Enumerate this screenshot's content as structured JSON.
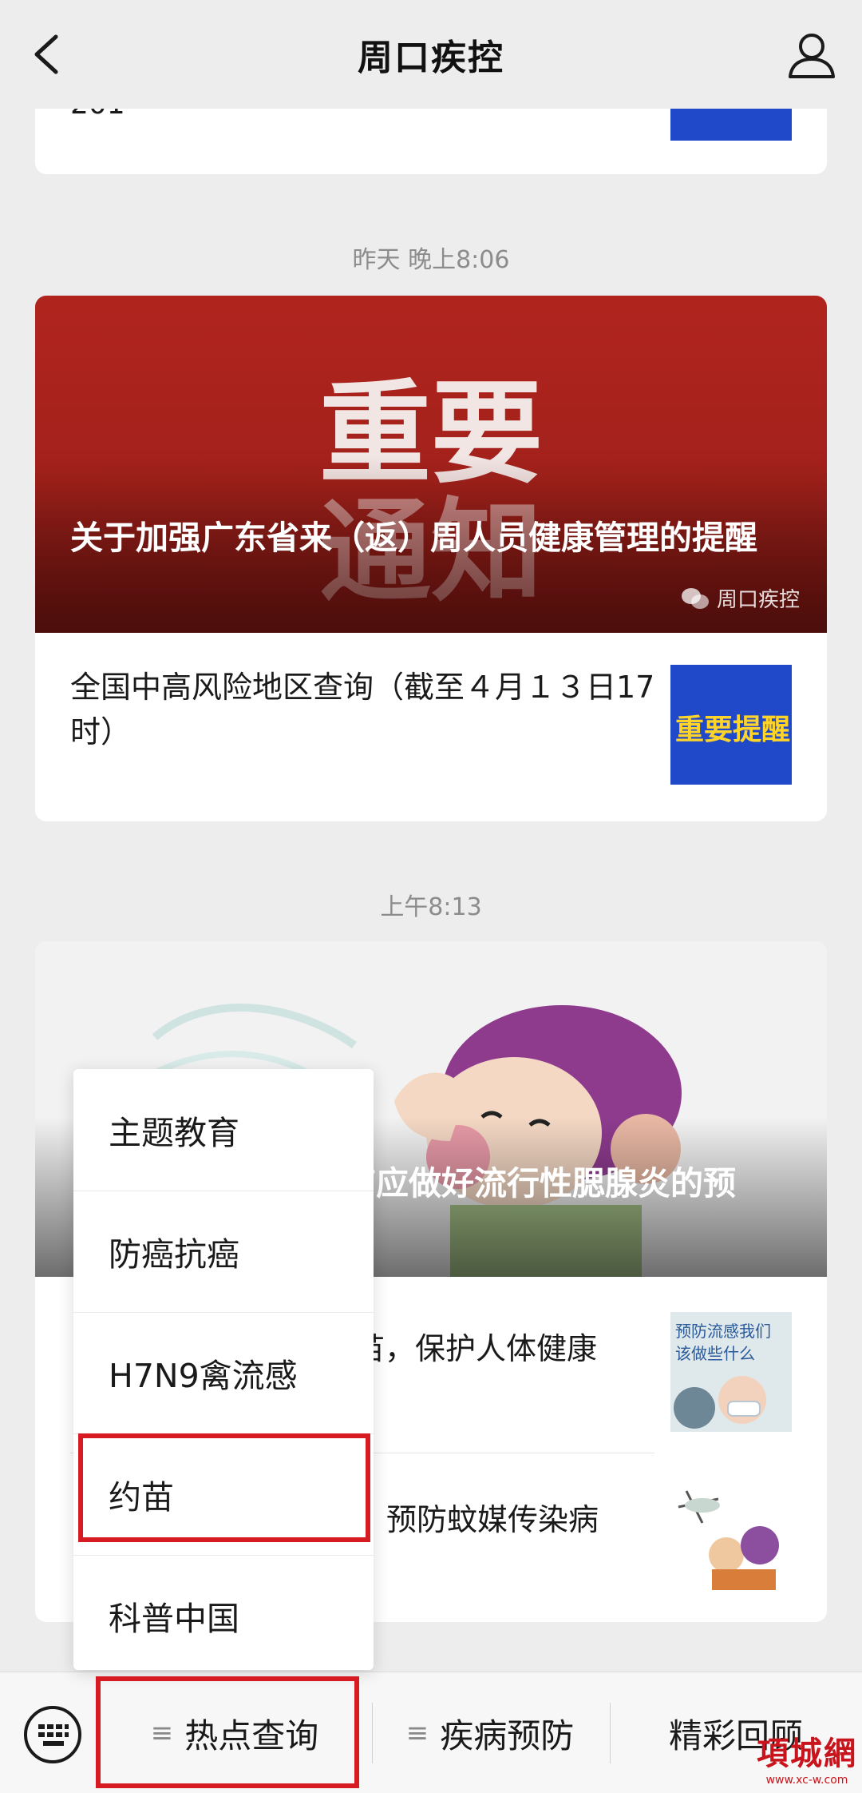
{
  "header": {
    "title": "周口疾控",
    "back_icon": "chevron-left-icon",
    "user_icon": "user-icon"
  },
  "top_card": {
    "partial_text": "201 -"
  },
  "group1": {
    "timestamp": "昨天 晚上8:06",
    "hero": {
      "image_text_1": "重要",
      "image_text_2": "通知",
      "title": "关于加强广东省来（返）周人员健康管理的提醒",
      "source": "周口疾控"
    },
    "rows": [
      {
        "text": "全国中高风险地区查询（截至４月１３日17时）",
        "thumb_text": "重要提醒"
      }
    ]
  },
  "group2": {
    "timestamp": "上午8:13",
    "hero": {
      "title_visible": "节应做好流行性腮腺炎的预"
    },
    "rows": [
      {
        "text_visible": "苗，保护人体健康",
        "thumb_text_1": "预防流感我们",
        "thumb_text_2": "该做些什么"
      },
      {
        "text_visible": "预防蚊媒传染病"
      }
    ]
  },
  "popup_menu": {
    "items": [
      "主题教育",
      "防癌抗癌",
      "H7N9禽流感",
      "约苗",
      "科普中国"
    ],
    "highlighted_index": 3
  },
  "bottom_bar": {
    "keyboard_icon": "keyboard-icon",
    "tabs": [
      {
        "label": "热点查询",
        "has_menu": true
      },
      {
        "label": "疾病预防",
        "has_menu": true
      },
      {
        "label": "精彩回顾",
        "has_menu": false
      }
    ],
    "active_tab_index": 0
  },
  "watermark": {
    "main": "項城網",
    "sub": "www.xc-w.com"
  },
  "colors": {
    "highlight": "#d61b22",
    "hero_red": "#a8231d",
    "thumb_blue": "#1f49c9"
  }
}
